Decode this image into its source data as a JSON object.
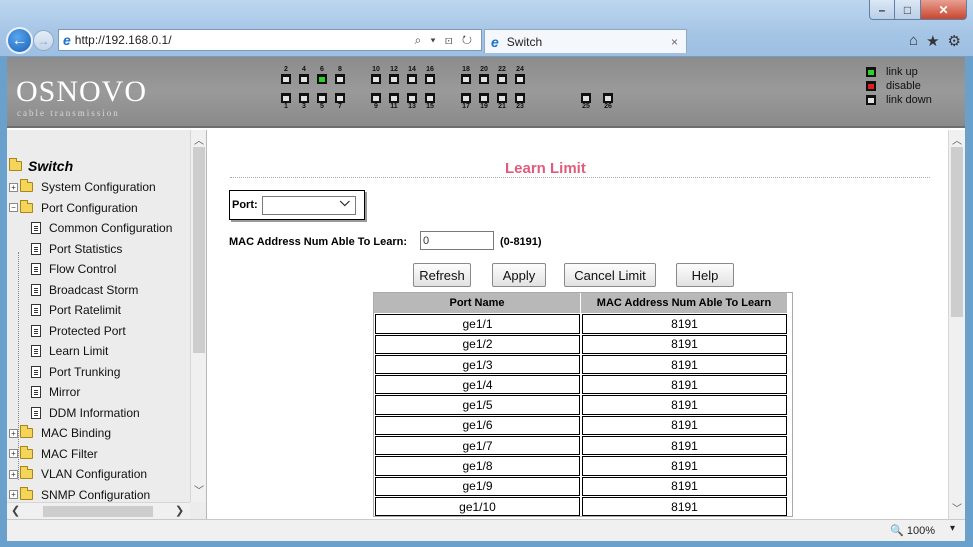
{
  "browser": {
    "address_url": "http://192.168.0.1/",
    "tab_title": "Switch",
    "tab_close": "×",
    "addr_controls": "⌕ ▾ ⊡ ↻",
    "zoom": "🔍 100%",
    "zoom_dropdown": "▾"
  },
  "banner": {
    "logo": "OSNOVO",
    "logo_sub": "cable transmission",
    "ports_top": [
      "2",
      "4",
      "6",
      "8",
      "10",
      "12",
      "14",
      "16",
      "18",
      "20",
      "22",
      "24"
    ],
    "ports_bottom": [
      "1",
      "3",
      "5",
      "7",
      "9",
      "11",
      "13",
      "15",
      "17",
      "19",
      "21",
      "23",
      "25",
      "26"
    ],
    "legend": [
      {
        "label": "link up",
        "color": "#2ad22a"
      },
      {
        "label": "disable",
        "color": "#e02020"
      },
      {
        "label": "link down",
        "color": "#e0e0e0"
      }
    ]
  },
  "tree": {
    "root": "Switch",
    "items": [
      {
        "label": "System Configuration",
        "kind": "folder",
        "expandable": true
      },
      {
        "label": "Port Configuration",
        "kind": "folder-open",
        "expandable": true
      },
      {
        "label": "Common Configuration",
        "kind": "doc"
      },
      {
        "label": "Port Statistics",
        "kind": "doc"
      },
      {
        "label": "Flow Control",
        "kind": "doc"
      },
      {
        "label": "Broadcast Storm",
        "kind": "doc"
      },
      {
        "label": "Port Ratelimit",
        "kind": "doc"
      },
      {
        "label": "Protected Port",
        "kind": "doc"
      },
      {
        "label": "Learn Limit",
        "kind": "doc"
      },
      {
        "label": "Port Trunking",
        "kind": "doc"
      },
      {
        "label": "Mirror",
        "kind": "doc"
      },
      {
        "label": "DDM Information",
        "kind": "doc"
      },
      {
        "label": "MAC Binding",
        "kind": "folder",
        "expandable": true
      },
      {
        "label": "MAC Filter",
        "kind": "folder",
        "expandable": true
      },
      {
        "label": "VLAN Configuration",
        "kind": "folder",
        "expandable": true
      },
      {
        "label": "SNMP Configuration",
        "kind": "folder",
        "expandable": true
      }
    ]
  },
  "main": {
    "title": "Learn Limit",
    "port_label": "Port:",
    "port_value": "",
    "mac_label": "MAC Address Num Able To Learn:",
    "mac_value": "0",
    "mac_range": "(0-8191)",
    "buttons": {
      "refresh": "Refresh",
      "apply": "Apply",
      "cancel": "Cancel Limit",
      "help": "Help"
    },
    "table": {
      "headers": [
        "Port Name",
        "MAC Address Num Able To Learn"
      ],
      "rows": [
        [
          "ge1/1",
          "8191"
        ],
        [
          "ge1/2",
          "8191"
        ],
        [
          "ge1/3",
          "8191"
        ],
        [
          "ge1/4",
          "8191"
        ],
        [
          "ge1/5",
          "8191"
        ],
        [
          "ge1/6",
          "8191"
        ],
        [
          "ge1/7",
          "8191"
        ],
        [
          "ge1/8",
          "8191"
        ],
        [
          "ge1/9",
          "8191"
        ],
        [
          "ge1/10",
          "8191"
        ]
      ]
    }
  }
}
